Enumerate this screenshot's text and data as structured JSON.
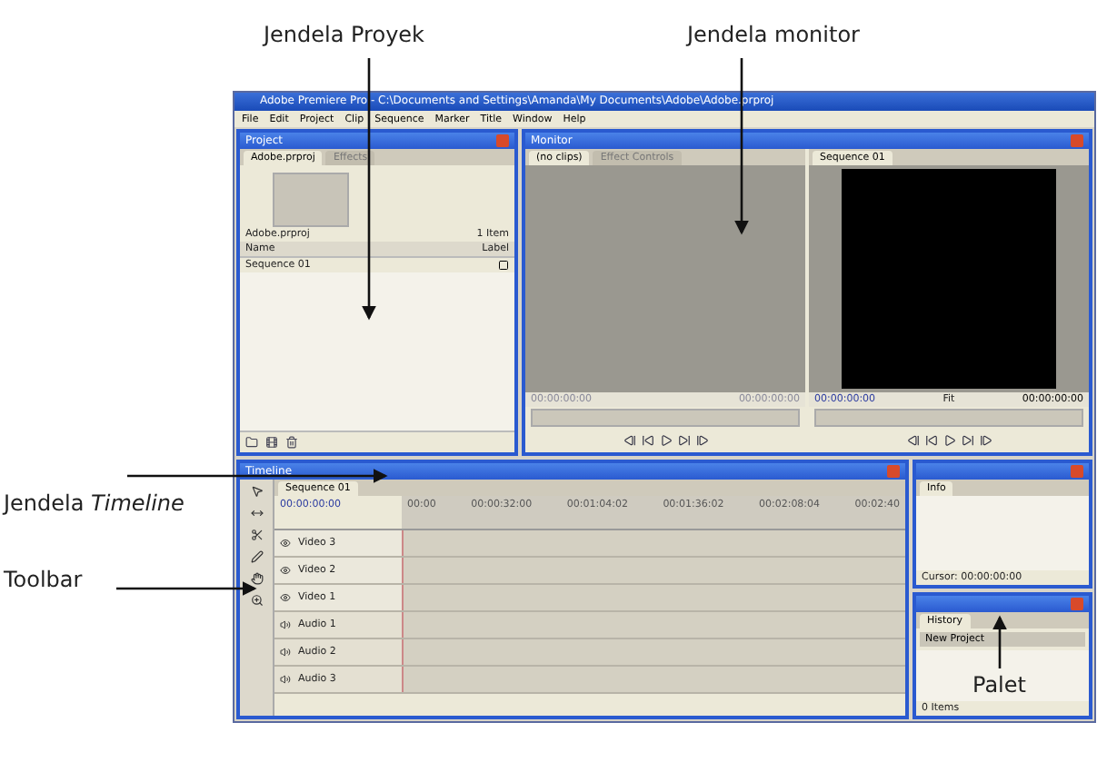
{
  "annotations": [
    {
      "text": "Jendela Proyek"
    },
    {
      "text": "Jendela monitor"
    },
    {
      "text": "Jendela *Timeline*"
    },
    {
      "text": "Toolbar"
    },
    {
      "text": "Palet"
    }
  ],
  "app": {
    "title": "Adobe Premiere Pro - C:\\Documents and Settings\\Amanda\\My Documents\\Adobe\\Adobe.prproj",
    "menu": [
      "File",
      "Edit",
      "Project",
      "Clip",
      "Sequence",
      "Marker",
      "Title",
      "Window",
      "Help"
    ],
    "project": {
      "title": "Project",
      "tabs": [
        {
          "label": "Adobe.prproj",
          "selected": true
        },
        {
          "label": "Effects",
          "selected": false
        }
      ],
      "bin": "Adobe.prproj",
      "count": "1 Item",
      "columns": [
        "Name",
        "Label"
      ],
      "items": [
        {
          "name": "Sequence 01"
        }
      ]
    },
    "monitor": {
      "title": "Monitor",
      "source_tabs": [
        {
          "label": "(no clips)",
          "selected": true
        },
        {
          "label": "Effect Controls",
          "selected": false
        }
      ],
      "source_in": "00:00:00:00",
      "source_out": "00:00:00:00",
      "program_tab": "Sequence 01",
      "program_in": "00:00:00:00",
      "zoom": "Fit",
      "program_out": "00:00:00:00"
    },
    "timeline": {
      "title": "Timeline",
      "tab": "Sequence 01",
      "timecode": "00:00:00:00",
      "ruler": [
        "00:00",
        "00:00:32:00",
        "00:01:04:02",
        "00:01:36:02",
        "00:02:08:04",
        "00:02:40"
      ],
      "tracks": [
        {
          "name": "Video 3",
          "kind": "video"
        },
        {
          "name": "Video 2",
          "kind": "video"
        },
        {
          "name": "Video 1",
          "kind": "video"
        },
        {
          "name": "Audio 1",
          "kind": "audio"
        },
        {
          "name": "Audio 2",
          "kind": "audio"
        },
        {
          "name": "Audio 3",
          "kind": "audio"
        }
      ]
    },
    "info": {
      "tab": "Info",
      "cursor": "Cursor: 00:00:00:00"
    },
    "history": {
      "tab": "History",
      "items": [
        "New Project"
      ],
      "count": "0 Items"
    }
  }
}
